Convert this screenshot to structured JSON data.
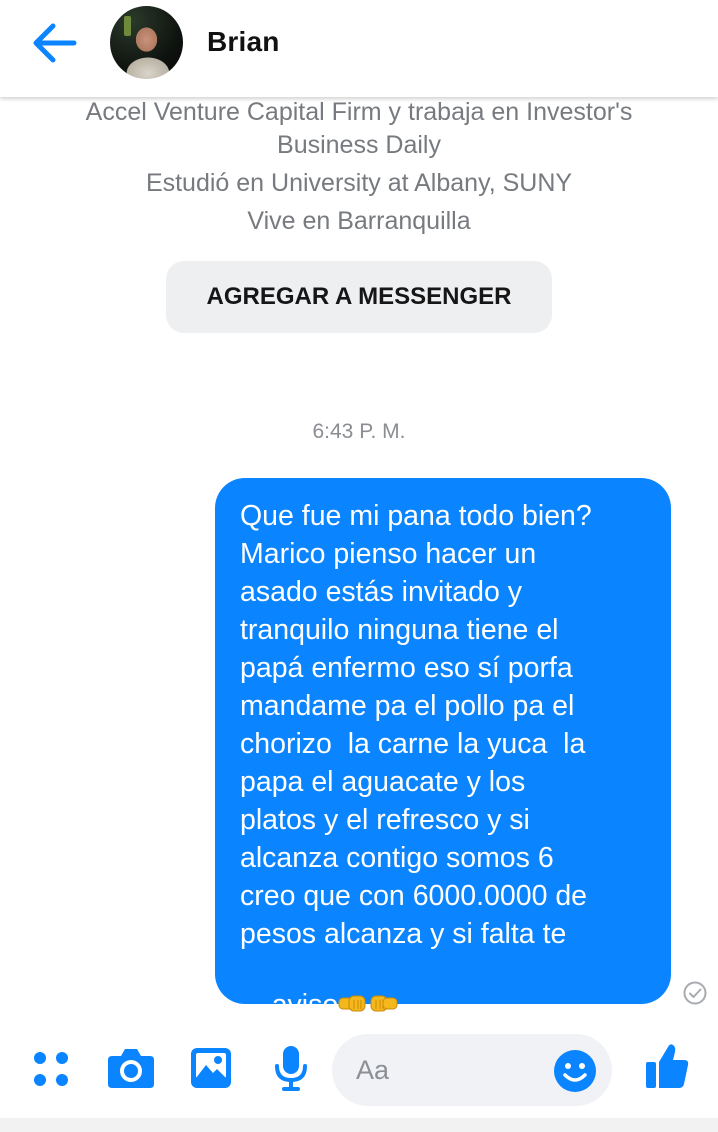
{
  "header": {
    "contact_name": "Brian"
  },
  "profile": {
    "info_lines": [
      "Accel Venture Capital Firm y trabaja en Investor's",
      "Business Daily",
      "Estudió en University at Albany, SUNY",
      "Vive en Barranquilla"
    ],
    "add_button_label": "AGREGAR A MESSENGER"
  },
  "conversation": {
    "timestamp": "6:43 P. M.",
    "message_lines": [
      "Que fue mi pana todo bien?",
      "Marico pienso hacer un",
      "asado estás invitado y",
      "tranquilo ninguna tiene el",
      "papá enfermo eso sí porfa",
      "mandame pa el pollo pa el",
      "chorizo  la carne la yuca  la",
      "papa el aguacate y los",
      "platos y el refresco y si",
      "alcanza contigo somos 6",
      "creo que con 6000.0000 de",
      "pesos alcanza y si falta te",
      "aviso"
    ],
    "message_trailing_emoji": "two fist-bump emoji (🤜🤛)",
    "status": "sent"
  },
  "composer": {
    "placeholder": "Aa",
    "icons": [
      "more-apps-icon",
      "camera-icon",
      "gallery-icon",
      "microphone-icon",
      "emoji-icon",
      "thumbs-up-icon"
    ]
  },
  "colors": {
    "accent": "#0a84ff",
    "bubble_text": "#ffffff",
    "secondary_text": "#777a7e",
    "button_bg": "#eeeff1"
  }
}
